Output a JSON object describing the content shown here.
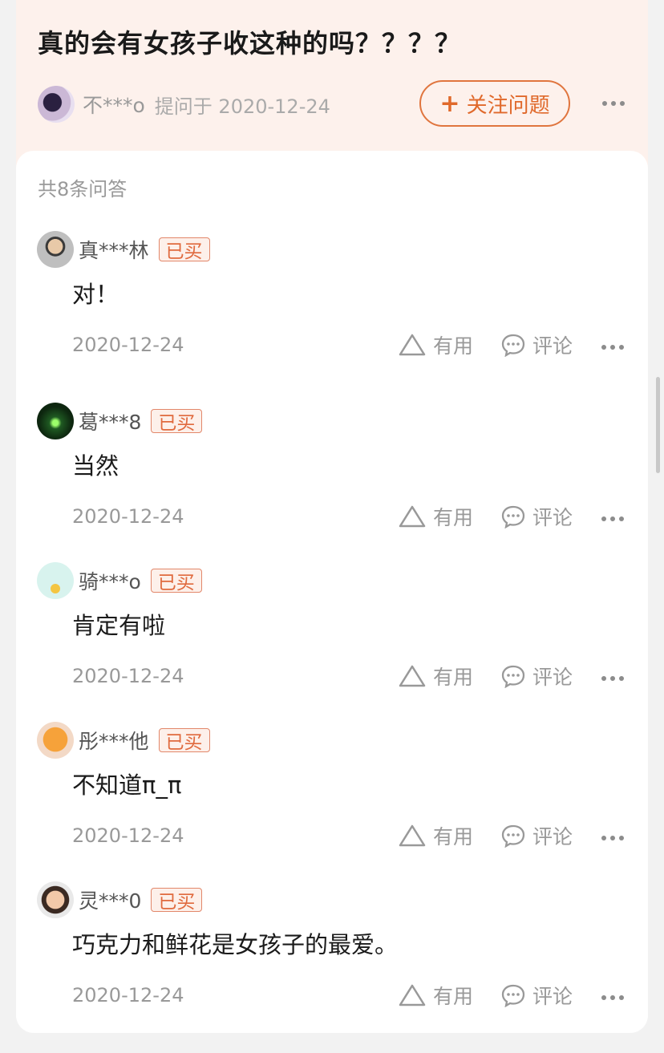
{
  "question": {
    "title": "真的会有女孩子收这种的吗？？？？",
    "asker_name": "不***o",
    "asked_meta": "提问于 2020-12-24",
    "follow_label": "关注问题",
    "follow_icon": "plus-icon"
  },
  "answers_count": "共8条问答",
  "answers": [
    {
      "name": "真***林",
      "badge": "已买",
      "text": "对！",
      "date": "2020-12-24",
      "useful": "有用",
      "comment": "评论"
    },
    {
      "name": "葛***8",
      "badge": "已买",
      "text": "当然",
      "date": "2020-12-24",
      "useful": "有用",
      "comment": "评论"
    },
    {
      "name": "骑***o",
      "badge": "已买",
      "text": "肯定有啦",
      "date": "2020-12-24",
      "useful": "有用",
      "comment": "评论"
    },
    {
      "name": "彤***他",
      "badge": "已买",
      "text": "不知道π_π",
      "date": "2020-12-24",
      "useful": "有用",
      "comment": "评论"
    },
    {
      "name": "灵***0",
      "badge": "已买",
      "text": "巧克力和鲜花是女孩子的最爱。",
      "date": "2020-12-24",
      "useful": "有用",
      "comment": "评论"
    }
  ],
  "colors": {
    "accent": "#e0692b",
    "header_bg": "#fdf1ec",
    "badge_bg": "#fdf0ea"
  },
  "icons": [
    "triangle-useful-icon",
    "comment-bubble-icon",
    "more-dots-icon",
    "plus-icon"
  ]
}
